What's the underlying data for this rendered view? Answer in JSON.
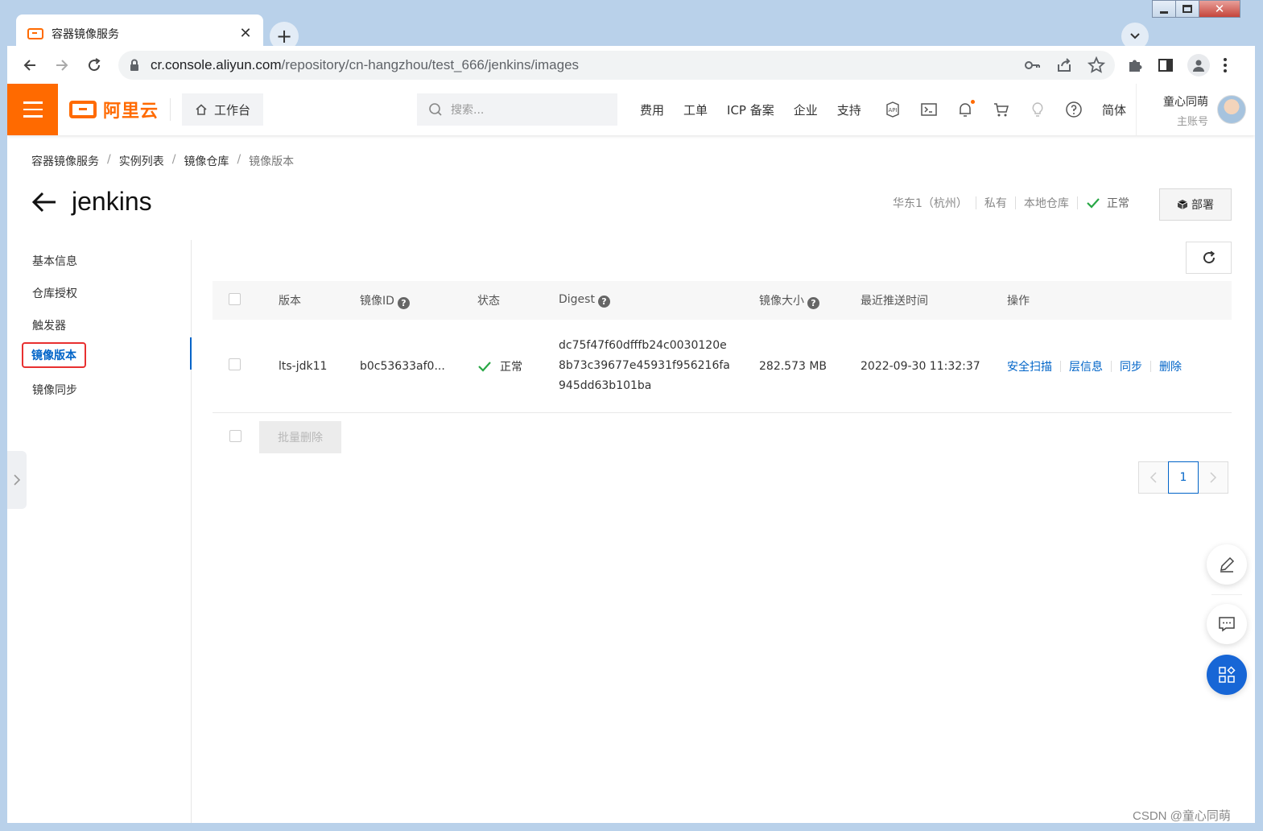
{
  "browser": {
    "tab_title": "容器镜像服务",
    "url_host": "cr.console.aliyun.com",
    "url_path": "/repository/cn-hangzhou/test_666/jenkins/images"
  },
  "topbar": {
    "logo_text": "阿里云",
    "workbench_label": "工作台",
    "search_placeholder": "搜索...",
    "nav": [
      "费用",
      "工单",
      "ICP 备案",
      "企业",
      "支持"
    ],
    "lang": "简体",
    "user_name": "童心同萌",
    "user_role": "主账号"
  },
  "breadcrumb": [
    "容器镜像服务",
    "实例列表",
    "镜像仓库",
    "镜像版本"
  ],
  "page": {
    "title": "jenkins",
    "region": "华东1（杭州）",
    "visibility": "私有",
    "repo_type": "本地仓库",
    "status": "正常",
    "deploy_label": "部署"
  },
  "sidenav": [
    "基本信息",
    "仓库授权",
    "触发器",
    "镜像版本",
    "镜像同步"
  ],
  "table": {
    "headers": [
      "版本",
      "镜像ID",
      "状态",
      "Digest",
      "镜像大小",
      "最近推送时间",
      "操作"
    ],
    "rows": [
      {
        "version": "lts-jdk11",
        "image_id": "b0c53633af0...",
        "status": "正常",
        "digest_lines": [
          "dc75f47f60dfffb24c0030120e",
          "8b73c39677e45931f956216fa",
          "945dd63b101ba"
        ],
        "size": "282.573 MB",
        "pushed": "2022-09-30 11:32:37",
        "ops": [
          "安全扫描",
          "层信息",
          "同步",
          "删除"
        ]
      }
    ],
    "bulk_delete": "批量删除"
  },
  "pager": {
    "current": "1"
  },
  "watermark": "CSDN @童心同萌",
  "colors": {
    "brand": "#ff6a00",
    "link": "#0064c8",
    "ok": "#28a745",
    "highlight": "#e83030"
  }
}
